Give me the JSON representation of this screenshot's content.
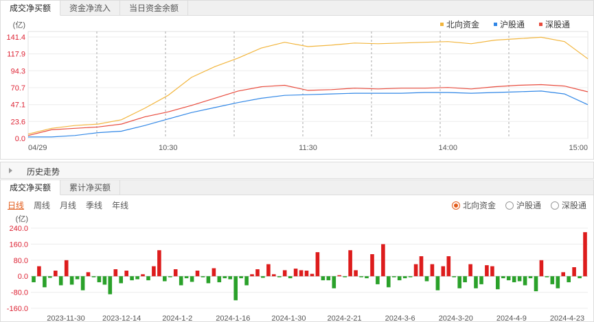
{
  "top_tabs": [
    "成交净买额",
    "资金净流入",
    "当日资金余额"
  ],
  "history_title": "历史走势",
  "bottom_tabs": [
    "成交净买额",
    "累计净买额"
  ],
  "periods": [
    "日线",
    "周线",
    "月线",
    "季线",
    "年线"
  ],
  "radios": [
    "北向资金",
    "沪股通",
    "深股通"
  ],
  "colors": {
    "north": "#f2b53c",
    "sh": "#2f86e6",
    "sz": "#e84a3c",
    "pos": "#dd1c1c",
    "neg": "#2aa12a",
    "accent": "#e25c1b"
  },
  "chart_data": [
    {
      "type": "line",
      "ylabel": "(亿)",
      "yticks": [
        0.0,
        23.6,
        47.1,
        70.7,
        94.3,
        117.9,
        141.4
      ],
      "ylim": [
        0,
        141.4
      ],
      "xticks": [
        "04/29",
        "10:30",
        "11:30",
        "14:00",
        "15:00"
      ],
      "x": [
        "09:30",
        "09:40",
        "09:50",
        "10:00",
        "10:10",
        "10:20",
        "10:30",
        "10:40",
        "10:50",
        "11:00",
        "11:10",
        "11:20",
        "11:30",
        "13:10",
        "13:20",
        "13:30",
        "13:40",
        "13:50",
        "14:00",
        "14:10",
        "14:20",
        "14:30",
        "14:40",
        "14:50",
        "15:00"
      ],
      "series": [
        {
          "name": "北向资金",
          "values": [
            6,
            14,
            18,
            20,
            26,
            42,
            60,
            85,
            100,
            112,
            126,
            134,
            128,
            130,
            133,
            132,
            133,
            134,
            135,
            132,
            137,
            139,
            141,
            135,
            111
          ]
        },
        {
          "name": "沪股通",
          "values": [
            2,
            2,
            4,
            8,
            10,
            18,
            27,
            36,
            43,
            50,
            56,
            60,
            61,
            62,
            63,
            63,
            63,
            64,
            64,
            63,
            64,
            65,
            66,
            62,
            47
          ]
        },
        {
          "name": "深股通",
          "values": [
            4,
            12,
            14,
            16,
            20,
            30,
            37,
            46,
            56,
            66,
            72,
            74,
            67,
            68,
            70,
            69,
            70,
            70,
            71,
            69,
            72,
            74,
            75,
            73,
            65
          ]
        }
      ]
    },
    {
      "type": "bar",
      "ylabel": "(亿)",
      "yticks": [
        240.0,
        160.0,
        80.0,
        0.0,
        -80.0,
        -160.0
      ],
      "ylim": [
        -160,
        240
      ],
      "xticks": [
        "2023-11-30",
        "2023-12-14",
        "2024-1-2",
        "2024-1-16",
        "2024-1-30",
        "2024-2-21",
        "2024-3-6",
        "2024-3-20",
        "2024-4-9",
        "2024-4-23"
      ],
      "series": [
        {
          "name": "北向资金",
          "values": [
            -30,
            50,
            -55,
            -8,
            28,
            -45,
            80,
            -42,
            -15,
            -70,
            20,
            -5,
            -30,
            -42,
            -90,
            35,
            -35,
            28,
            -20,
            -15,
            10,
            -20,
            50,
            130,
            -25,
            -5,
            35,
            -45,
            -10,
            -28,
            28,
            -5,
            -35,
            40,
            -30,
            -10,
            -15,
            -120,
            -10,
            -45,
            10,
            35,
            -8,
            60,
            10,
            -5,
            30,
            -10,
            38,
            30,
            28,
            12,
            120,
            -20,
            -20,
            -60,
            5,
            -5,
            130,
            30,
            -5,
            -10,
            110,
            -40,
            160,
            -55,
            -5,
            -20,
            -10,
            -5,
            60,
            100,
            -25,
            60,
            -70,
            50,
            100,
            -5,
            -60,
            -30,
            60,
            -60,
            -40,
            55,
            50,
            -65,
            -10,
            -20,
            -30,
            -25,
            -45,
            -10,
            -75,
            80,
            -5,
            -40,
            -60,
            20,
            -30,
            45,
            -10,
            220
          ]
        }
      ]
    }
  ]
}
